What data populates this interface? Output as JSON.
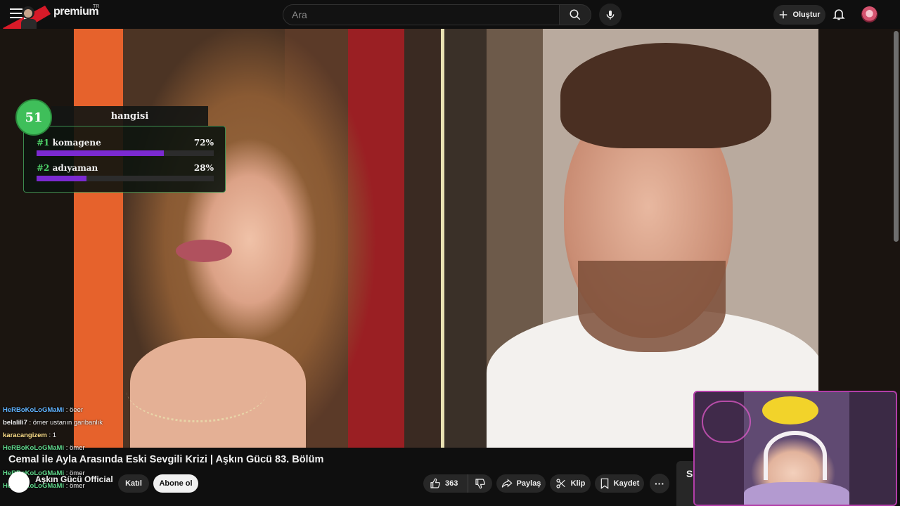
{
  "header": {
    "logo_text": "premium",
    "logo_region": "TR",
    "search_placeholder": "Ara",
    "create_label": "Oluştur"
  },
  "poll": {
    "number": "51",
    "question": "hangisi",
    "options": [
      {
        "rank": "#1",
        "label": "komagene",
        "percent_label": "72%",
        "percent": 72
      },
      {
        "rank": "#2",
        "label": "adıyaman",
        "percent_label": "28%",
        "percent": 28
      }
    ],
    "accent_color": "#3fbf5a",
    "bar_color": "#7b2ad1"
  },
  "chat": [
    {
      "user": "HeRBoKoLoGMaMi",
      "message": " : öeer",
      "color": "#5fb3ff"
    },
    {
      "user": "belalili7",
      "message": " : ömer ustanın garibanlık",
      "color": "#f1f1f1"
    },
    {
      "user": "karacangizem",
      "message": " : 1",
      "color": "#f1f1f1"
    },
    {
      "user": "HeRBoKoLoGMaMi",
      "message": " : ömer",
      "color": "#5fb3ff"
    },
    {
      "user": "HeRBoKoLoGMaMi",
      "message": " : ömer",
      "color": "#5fb3ff"
    },
    {
      "user": "HeRBoKoLoGMaMi",
      "message": " : ömer",
      "color": "#5fb3ff"
    }
  ],
  "video": {
    "title": "Cemal ile Ayla Arasında Eski Sevgili Krizi | Aşkın Gücü 83. Bölüm",
    "channel": "Aşkın Gücü Official"
  },
  "actions": {
    "join": "Katıl",
    "subscribe": "Abone ol",
    "likes": "363",
    "share": "Paylaş",
    "clip": "Klip",
    "save": "Kaydet",
    "more": "···"
  },
  "side_peek": "S"
}
